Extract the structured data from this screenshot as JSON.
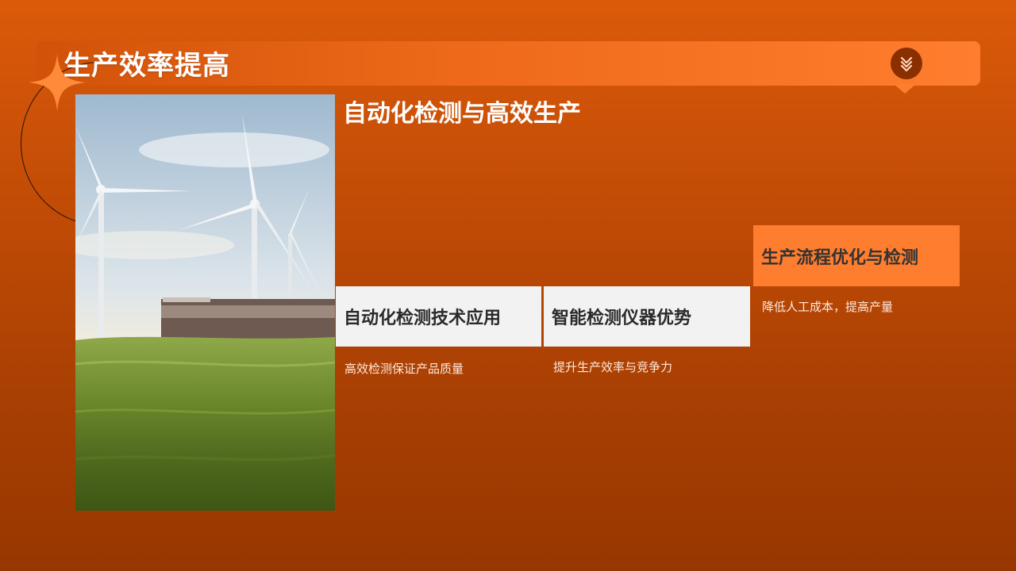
{
  "slide": {
    "title": "生产效率提高",
    "section_title": "自动化检测与高效生产",
    "image_alt": "wind-turbines-over-grass-field",
    "scroll_icon": "chevrons-down-icon",
    "cards": [
      {
        "label": "自动化检测技术应用",
        "desc": "高效检测保证产品质量"
      },
      {
        "label": "智能检测仪器优势",
        "desc": "提升生产效率与竞争力"
      },
      {
        "label": "生产流程优化与检测",
        "desc": "降低人工成本，提高产量"
      }
    ]
  },
  "colors": {
    "accent": "#ff7d2e",
    "dark_accent": "#8a2f00",
    "card_bg": "#f2f2f2"
  }
}
